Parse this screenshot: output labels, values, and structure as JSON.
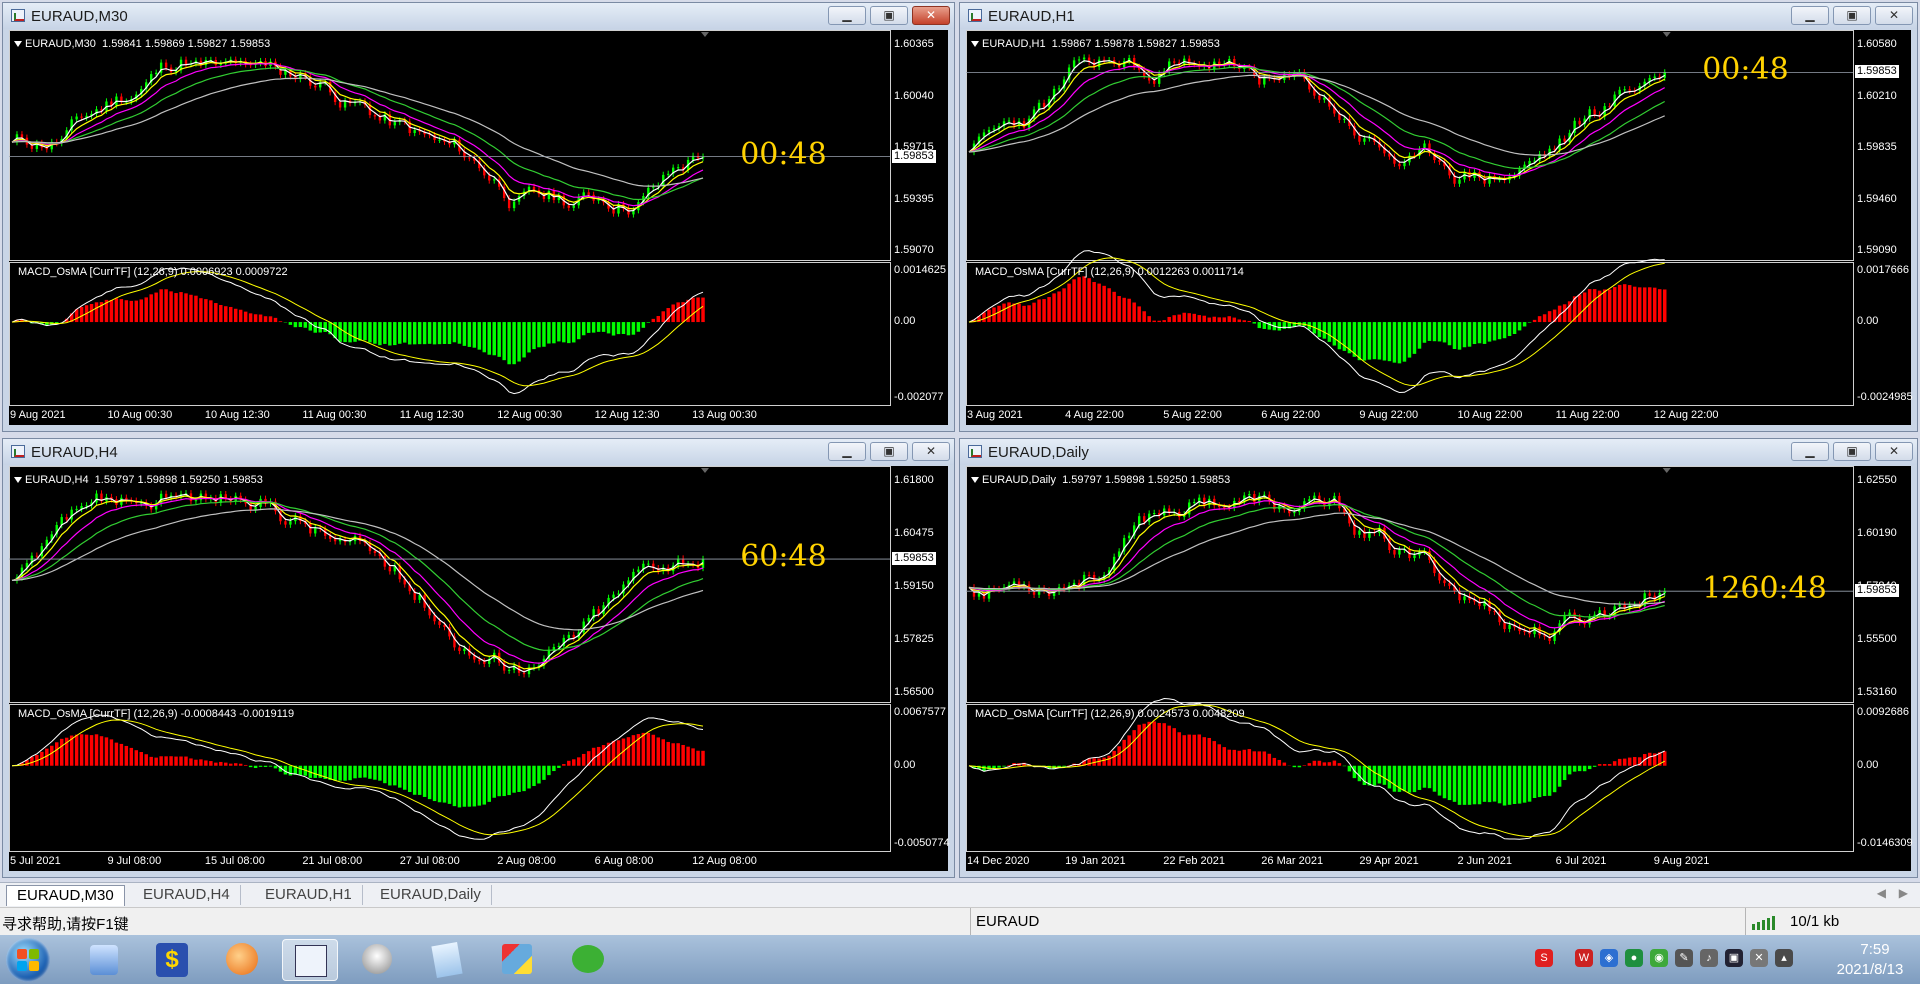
{
  "windows": [
    {
      "id": "m30",
      "title": "EURAUD,M30",
      "symbol_line": "EURAUD,M30  1.59841 1.59869 1.59827 1.59853",
      "countdown": "00:48",
      "price_ticks": [
        "1.60365",
        "1.60040",
        "1.59715",
        "1.59395",
        "1.59070"
      ],
      "current_price": "1.59853",
      "macd_line": "MACD_OsMA [CurrTF] (12,26,9) 0.0006923 0.0009722",
      "macd_ticks": [
        "0.0014625",
        "0.00",
        "-0.002077"
      ],
      "time_ticks": [
        "9 Aug 2021",
        "10 Aug 00:30",
        "10 Aug 12:30",
        "11 Aug 00:30",
        "11 Aug 12:30",
        "12 Aug 00:30",
        "12 Aug 12:30",
        "13 Aug 00:30"
      ],
      "close_active": true
    },
    {
      "id": "h1",
      "title": "EURAUD,H1",
      "symbol_line": "EURAUD,H1  1.59867 1.59878 1.59827 1.59853",
      "countdown": "00:48",
      "price_ticks": [
        "1.60580",
        "1.60210",
        "1.59835",
        "1.59460",
        "1.59090"
      ],
      "current_price": "1.59853",
      "macd_line": "MACD_OsMA [CurrTF] (12,26,9) 0.0012263 0.0011714",
      "macd_ticks": [
        "0.0017666",
        "0.00",
        "-0.0024985"
      ],
      "time_ticks": [
        "3 Aug 2021",
        "4 Aug 22:00",
        "5 Aug 22:00",
        "6 Aug 22:00",
        "9 Aug 22:00",
        "10 Aug 22:00",
        "11 Aug 22:00",
        "12 Aug 22:00"
      ],
      "close_active": false
    },
    {
      "id": "h4",
      "title": "EURAUD,H4",
      "symbol_line": "EURAUD,H4  1.59797 1.59898 1.59250 1.59853",
      "countdown": "60:48",
      "price_ticks": [
        "1.61800",
        "1.60475",
        "1.59150",
        "1.57825",
        "1.56500"
      ],
      "current_price": "1.59853",
      "macd_line": "MACD_OsMA [CurrTF] (12,26,9) -0.0008443 -0.0019119",
      "macd_ticks": [
        "0.0067577",
        "0.00",
        "-0.0050774"
      ],
      "time_ticks": [
        "5 Jul 2021",
        "9 Jul 08:00",
        "15 Jul 08:00",
        "21 Jul 08:00",
        "27 Jul 08:00",
        "2 Aug 08:00",
        "6 Aug 08:00",
        "12 Aug 08:00"
      ],
      "close_active": false
    },
    {
      "id": "daily",
      "title": "EURAUD,Daily",
      "symbol_line": "EURAUD,Daily  1.59797 1.59898 1.59250 1.59853",
      "countdown": "1260:48",
      "price_ticks": [
        "1.62550",
        "1.60190",
        "1.57840",
        "1.55500",
        "1.53160"
      ],
      "current_price": "1.59853",
      "macd_line": "MACD_OsMA [CurrTF] (12,26,9) 0.0024573 0.0048209",
      "macd_ticks": [
        "0.0092686",
        "0.00",
        "-0.0146309"
      ],
      "time_ticks": [
        "14 Dec 2020",
        "19 Jan 2021",
        "22 Feb 2021",
        "26 Mar 2021",
        "29 Apr 2021",
        "2 Jun 2021",
        "6 Jul 2021",
        "9 Aug 2021"
      ],
      "close_active": false
    }
  ],
  "tabs": [
    "EURAUD,M30",
    "EURAUD,H4",
    "EURAUD,H1",
    "EURAUD,Daily"
  ],
  "active_tab": 0,
  "status": {
    "help": "寻求帮助,请按F1键",
    "profile": "EURAUD",
    "traffic": "10/1 kb"
  },
  "taskbar": {
    "time": "7:59",
    "date": "2021/8/13"
  },
  "colors": {
    "bull": "#00ff00",
    "bear": "#ff0000",
    "countdown": "#ffd200",
    "ma_white": "#ffffff",
    "ma_yellow": "#ffff00",
    "ma_magenta": "#ff00ff",
    "ma_green": "#32cd32",
    "ma_gray": "#c0c0c0"
  }
}
